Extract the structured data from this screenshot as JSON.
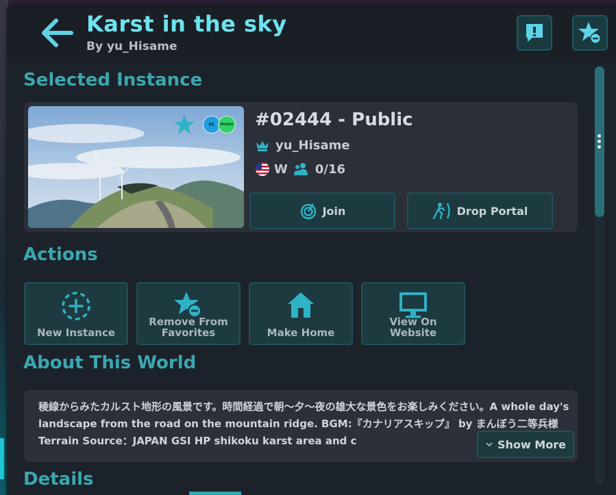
{
  "header": {
    "title": "Karst in the sky",
    "byline": "By yu_Hisame",
    "back_icon": "arrow-left-icon",
    "report_icon": "report-icon",
    "unfavorite_icon": "star-minus-icon"
  },
  "selected_instance": {
    "heading": "Selected Instance",
    "instance_id": "#02444 - Public",
    "owner": "yu_Hisame",
    "region": "W",
    "occupancy": "0/16",
    "join_label": "Join",
    "drop_portal_label": "Drop Portal",
    "thumb_badges": [
      "PC",
      "Mobile"
    ]
  },
  "actions": {
    "heading": "Actions",
    "items": [
      {
        "label": "New Instance",
        "icon": "plus-circle-dashed-icon"
      },
      {
        "label": "Remove From Favorites",
        "icon": "star-minus-icon"
      },
      {
        "label": "Make Home",
        "icon": "home-icon"
      },
      {
        "label": "View On Website",
        "icon": "monitor-icon"
      }
    ]
  },
  "about": {
    "heading": "About This World",
    "description": "稜線からみたカルスト地形の風景です。時間経過で朝〜夕〜夜の雄大な景色をお楽しみください。A whole day's landscape from the road on the mountain ridge. BGM:『カナリアスキップ』 by まんぼう二等兵様 Terrain Source：JAPAN GSI HP shikoku karst area and c",
    "show_more_label": "Show More"
  },
  "details": {
    "heading": "Details"
  },
  "colors": {
    "accent": "#6de3ee",
    "section": "#3ba7b0",
    "button_bg": "#1d3a40"
  }
}
